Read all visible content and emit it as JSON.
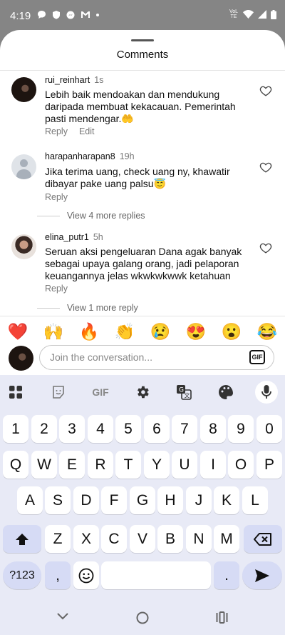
{
  "status_bar": {
    "time": "4:19",
    "volte_label": "VoLTE"
  },
  "sheet": {
    "title": "Comments"
  },
  "comments": [
    {
      "user": "rui_reinhart",
      "time": "1s",
      "text": "Lebih baik mendoakan dan mendukung daripada membuat kekacauan. Pemerintah pasti mendengar.🤲",
      "reply_label": "Reply",
      "edit_label": "Edit"
    },
    {
      "user": "harapanharapan8",
      "time": "19h",
      "text": "Jika terima uang, check uang ny, khawatir dibayar pake uang palsu😇",
      "reply_label": "Reply",
      "view_replies": "View 4 more replies"
    },
    {
      "user": "elina_putr1",
      "time": "5h",
      "text": "Seruan aksi pengeluaran Dana agak banyak sebagai upaya galang orang, jadi pelaporan keuangannya jelas wkwkwkwwk ketahuan",
      "reply_label": "Reply",
      "view_replies": "View 1 more reply"
    }
  ],
  "emoji_bar": [
    "❤️",
    "🙌",
    "🔥",
    "👏",
    "😢",
    "😍",
    "😮",
    "😂"
  ],
  "composer": {
    "placeholder": "Join the conversation...",
    "gif_label": "GIF"
  },
  "keyboard": {
    "toolbar_gif_label": "GIF",
    "row_numbers": [
      "1",
      "2",
      "3",
      "4",
      "5",
      "6",
      "7",
      "8",
      "9",
      "0"
    ],
    "row1": [
      "Q",
      "W",
      "E",
      "R",
      "T",
      "Y",
      "U",
      "I",
      "O",
      "P"
    ],
    "row2": [
      "A",
      "S",
      "D",
      "F",
      "G",
      "H",
      "J",
      "K",
      "L"
    ],
    "row3": [
      "Z",
      "X",
      "C",
      "V",
      "B",
      "N",
      "M"
    ],
    "symbols_label": "?123",
    "comma": ",",
    "period": "."
  },
  "colors": {
    "status_bg": "#858585",
    "keyboard_bg": "#e8eaf6",
    "func_key": "#d6dbf5",
    "emoji_heart": "#e0245e"
  }
}
